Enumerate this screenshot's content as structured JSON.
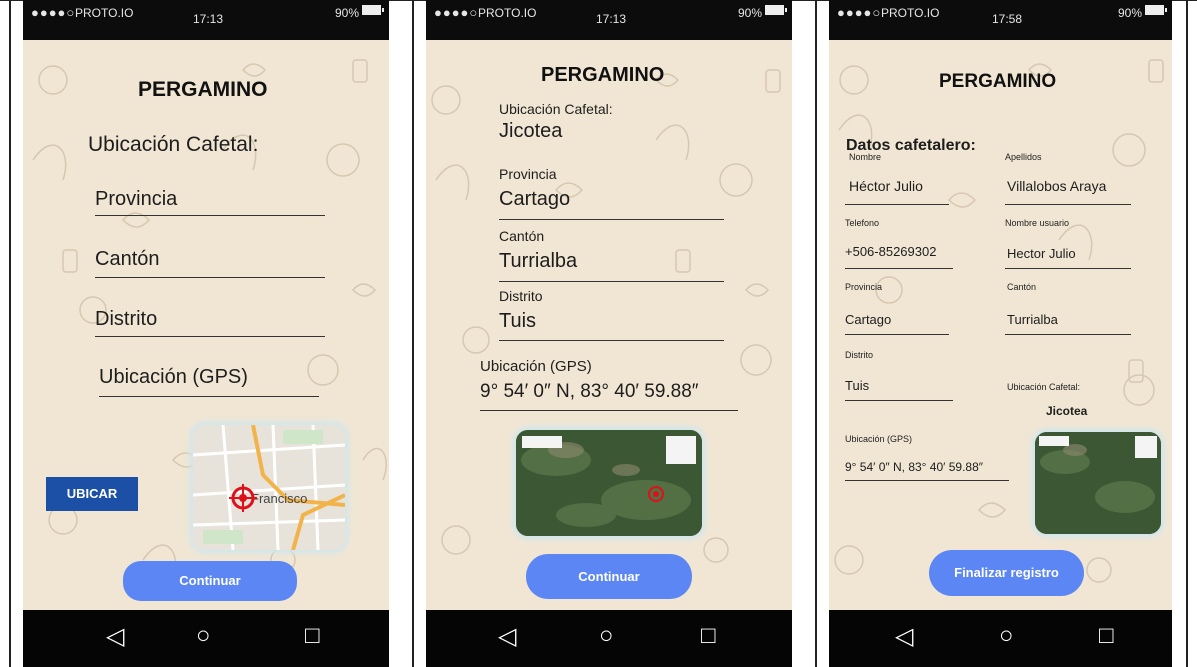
{
  "status": {
    "signal": "●●●●○",
    "carrier": "PROTO.IO",
    "battery": "90%"
  },
  "screens": [
    {
      "time": "17:13",
      "title": "PERGAMINO",
      "section": "Ubicación Cafetal:",
      "fields": {
        "provincia": "Provincia",
        "canton": "Cantón",
        "distrito": "Distrito",
        "gps": "Ubicación (GPS)"
      },
      "locate_button": "UBICAR",
      "map_label": "Francisco",
      "continue_button": "Continuar"
    },
    {
      "time": "17:13",
      "title": "PERGAMINO",
      "fields": [
        {
          "label": "Ubicación Cafetal:",
          "value": "Jicotea"
        },
        {
          "label": "Provincia",
          "value": "Cartago"
        },
        {
          "label": "Cantón",
          "value": "Turrialba"
        },
        {
          "label": "Distrito",
          "value": "Tuis"
        }
      ],
      "gps_label": "Ubicación (GPS)",
      "gps_value": "9° 54′ 0″ N, 83° 40′ 59.88″",
      "continue_button": "Continuar"
    },
    {
      "time": "17:58",
      "title": "PERGAMINO",
      "subtitle": "Datos cafetalero:",
      "fields": {
        "nombre_label": "Nombre",
        "nombre": "Héctor Julio",
        "apellidos_label": "Apellidos",
        "apellidos": "Villalobos Araya",
        "telefono_label": "Telefono",
        "telefono": "+506-85269302",
        "usuario_label": "Nombre usuario",
        "usuario": "Hector Julio",
        "provincia_label": "Provincia",
        "provincia": "Cartago",
        "canton_label": "Cantón",
        "canton": "Turrialba",
        "distrito_label": "Distrito",
        "distrito": "Tuis",
        "ubicacion_label": "Ubicación Cafetal:",
        "ubicacion": "Jicotea",
        "gps_label": "Ubicación (GPS)",
        "gps": "9° 54′ 0″ N, 83° 40′ 59.88″"
      },
      "finish_button": "Finalizar registro"
    }
  ],
  "nav": {
    "back": "◁",
    "home": "○",
    "recent": "□"
  },
  "colors": {
    "background": "#f1e6d4",
    "primary": "#5b86f4",
    "dark_button": "#1c4fa6",
    "marker": "#e0101a"
  }
}
